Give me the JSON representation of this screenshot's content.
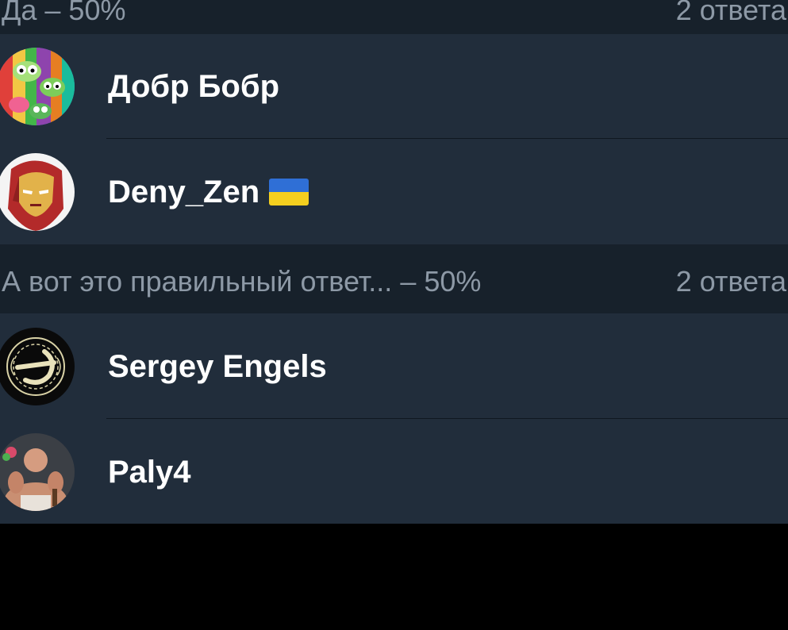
{
  "sections": [
    {
      "title": "Да – 50%",
      "count": "2 ответа",
      "voters": [
        {
          "name": "Добр Бобр",
          "avatar": "colorful-cartoon-avatar"
        },
        {
          "name": "Deny_Zen",
          "avatar": "iron-man-avatar",
          "flag": "ukraine-flag",
          "flag_colors": [
            "#2f6fd6",
            "#f4cf1f"
          ]
        }
      ]
    },
    {
      "title": "А вот это правильный ответ... – 50%",
      "count": "2 ответа",
      "voters": [
        {
          "name": "Sergey Engels",
          "avatar": "ornamental-emblem-avatar"
        },
        {
          "name": "Paly4",
          "avatar": "muscular-man-photo-avatar"
        }
      ]
    }
  ],
  "colors": {
    "background": "#000000",
    "list_background": "#212d3b",
    "section_header_background": "#17212b",
    "section_header_text": "#8d99a6",
    "name_text": "#ffffff"
  }
}
